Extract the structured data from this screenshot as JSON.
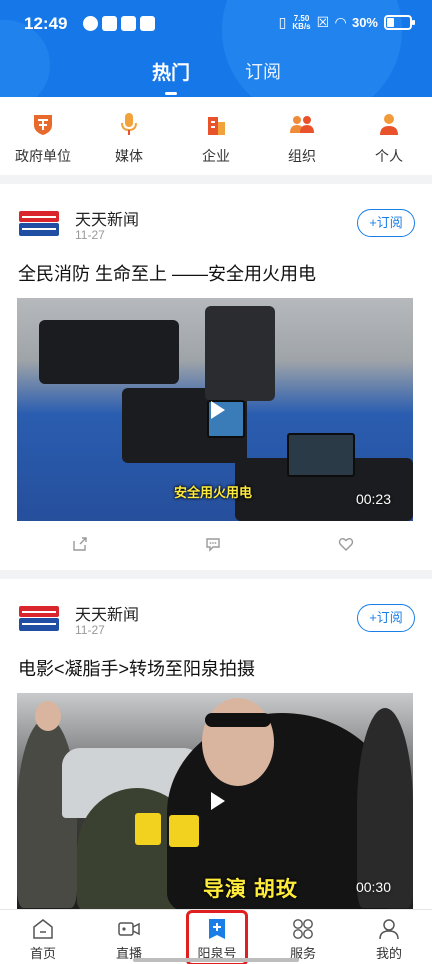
{
  "status_bar": {
    "time": "12:49",
    "net_speed_value": "7.50",
    "net_speed_unit": "KB/s",
    "battery": "30%"
  },
  "tabs": [
    {
      "label": "热门",
      "active": true
    },
    {
      "label": "订阅",
      "active": false
    }
  ],
  "categories": [
    {
      "label": "政府单位",
      "icon": "government-icon",
      "color": "#e8692c"
    },
    {
      "label": "媒体",
      "icon": "microphone-icon",
      "color": "#f2a23a"
    },
    {
      "label": "企业",
      "icon": "building-icon",
      "color": "#e8532c"
    },
    {
      "label": "组织",
      "icon": "group-icon",
      "color": "#f08b3a"
    },
    {
      "label": "个人",
      "icon": "person-icon",
      "color": "#f29a3a"
    }
  ],
  "feed": [
    {
      "source": "天天新闻",
      "date": "11-27",
      "subscribe_label": "+订阅",
      "title": "全民消防 生命至上 ——安全用火用电",
      "video_subtitle": "安全用火用电",
      "duration": "00:23"
    },
    {
      "source": "天天新闻",
      "date": "11-27",
      "subscribe_label": "+订阅",
      "title": "电影<凝脂手>转场至阳泉拍摄",
      "video_subtitle": "导演 胡玫",
      "duration": "00:30"
    }
  ],
  "avatar_logo_text": "天天新闻",
  "bottom_nav": [
    {
      "label": "首页",
      "icon": "home-icon"
    },
    {
      "label": "直播",
      "icon": "video-camera-icon"
    },
    {
      "label": "阳泉号",
      "icon": "add-icon",
      "highlighted": true
    },
    {
      "label": "服务",
      "icon": "grid-icon"
    },
    {
      "label": "我的",
      "icon": "profile-icon"
    }
  ],
  "colors": {
    "header_blue": "#1678e8",
    "accent_blue": "#1a7ee6",
    "highlight_red": "#e02020"
  }
}
